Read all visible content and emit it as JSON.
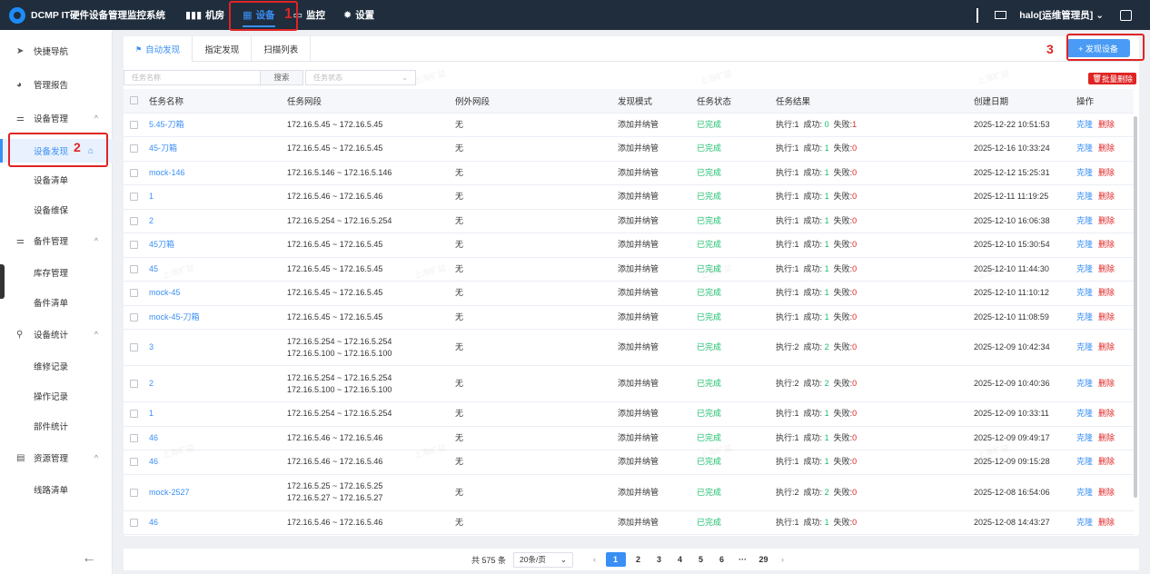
{
  "header": {
    "brand": "DCMP IT硬件设备管理监控系统",
    "nav": [
      {
        "label": "机房",
        "icon": "bar-chart-icon"
      },
      {
        "label": "设备",
        "icon": "grid-icon"
      },
      {
        "label": "监控",
        "icon": "monitor-icon"
      },
      {
        "label": "设置",
        "icon": "gear-icon"
      }
    ],
    "user": "halo[运维管理员]",
    "annotations": {
      "n1": "1",
      "n2": "2",
      "n3": "3"
    }
  },
  "sidebar": {
    "items": [
      {
        "label": "快捷导航",
        "icon": "send-icon"
      },
      {
        "label": "管理报告",
        "icon": "pie-icon"
      },
      {
        "label": "设备管理",
        "icon": "sliders-icon",
        "chevron": "^"
      },
      {
        "label": "设备发现"
      },
      {
        "label": "设备清单"
      },
      {
        "label": "设备维保"
      },
      {
        "label": "备件管理",
        "icon": "sliders-icon",
        "chevron": "^"
      },
      {
        "label": "库存管理"
      },
      {
        "label": "备件清单"
      },
      {
        "label": "设备统计",
        "icon": "search-icon",
        "chevron": "^"
      },
      {
        "label": "维修记录"
      },
      {
        "label": "操作记录"
      },
      {
        "label": "部件统计"
      },
      {
        "label": "资源管理",
        "icon": "table-icon",
        "chevron": "^"
      },
      {
        "label": "线路清单"
      }
    ]
  },
  "tabs": [
    "自动发现",
    "指定发现",
    "扫描列表"
  ],
  "buttons": {
    "add": "+ 发现设备",
    "batch_delete": "批量删除",
    "search": "搜索"
  },
  "filters": {
    "task_name_placeholder": "任务名称",
    "task_status_placeholder": "任务状态"
  },
  "table": {
    "columns": [
      "任务名称",
      "任务网段",
      "例外网段",
      "发现模式",
      "任务状态",
      "任务结果",
      "创建日期",
      "操作"
    ],
    "labels": {
      "exec": "执行:",
      "success": "成功:",
      "fail": "失败:",
      "clone": "克隆",
      "delete": "删除"
    },
    "rows": [
      {
        "name": "5.45-刀箱",
        "range": [
          "172.16.5.45 ~ 172.16.5.45"
        ],
        "exclude": "无",
        "mode": "添加并纳管",
        "status": "已完成",
        "exec": "1",
        "ok": "0",
        "fail": "1",
        "date": "2025-12-22 10:51:53"
      },
      {
        "name": "45-刀箱",
        "range": [
          "172.16.5.45 ~ 172.16.5.45"
        ],
        "exclude": "无",
        "mode": "添加并纳管",
        "status": "已完成",
        "exec": "1",
        "ok": "1",
        "fail": "0",
        "date": "2025-12-16 10:33:24"
      },
      {
        "name": "mock-146",
        "range": [
          "172.16.5.146 ~ 172.16.5.146"
        ],
        "exclude": "无",
        "mode": "添加并纳管",
        "status": "已完成",
        "exec": "1",
        "ok": "1",
        "fail": "0",
        "date": "2025-12-12 15:25:31"
      },
      {
        "name": "1",
        "range": [
          "172.16.5.46 ~ 172.16.5.46"
        ],
        "exclude": "无",
        "mode": "添加并纳管",
        "status": "已完成",
        "exec": "1",
        "ok": "1",
        "fail": "0",
        "date": "2025-12-11 11:19:25"
      },
      {
        "name": "2",
        "range": [
          "172.16.5.254 ~ 172.16.5.254"
        ],
        "exclude": "无",
        "mode": "添加并纳管",
        "status": "已完成",
        "exec": "1",
        "ok": "1",
        "fail": "0",
        "date": "2025-12-10 16:06:38"
      },
      {
        "name": "45刀箱",
        "range": [
          "172.16.5.45 ~ 172.16.5.45"
        ],
        "exclude": "无",
        "mode": "添加并纳管",
        "status": "已完成",
        "exec": "1",
        "ok": "1",
        "fail": "0",
        "date": "2025-12-10 15:30:54"
      },
      {
        "name": "45",
        "range": [
          "172.16.5.45 ~ 172.16.5.45"
        ],
        "exclude": "无",
        "mode": "添加并纳管",
        "status": "已完成",
        "exec": "1",
        "ok": "1",
        "fail": "0",
        "date": "2025-12-10 11:44:30"
      },
      {
        "name": "mock-45",
        "range": [
          "172.16.5.45 ~ 172.16.5.45"
        ],
        "exclude": "无",
        "mode": "添加并纳管",
        "status": "已完成",
        "exec": "1",
        "ok": "1",
        "fail": "0",
        "date": "2025-12-10 11:10:12"
      },
      {
        "name": "mock-45-刀箱",
        "range": [
          "172.16.5.45 ~ 172.16.5.45"
        ],
        "exclude": "无",
        "mode": "添加并纳管",
        "status": "已完成",
        "exec": "1",
        "ok": "1",
        "fail": "0",
        "date": "2025-12-10 11:08:59"
      },
      {
        "name": "3",
        "range": [
          "172.16.5.254 ~ 172.16.5.254",
          "172.16.5.100 ~ 172.16.5.100"
        ],
        "exclude": "无",
        "mode": "添加并纳管",
        "status": "已完成",
        "exec": "2",
        "ok": "2",
        "fail": "0",
        "date": "2025-12-09 10:42:34"
      },
      {
        "name": "2",
        "range": [
          "172.16.5.254 ~ 172.16.5.254",
          "172.16.5.100 ~ 172.16.5.100"
        ],
        "exclude": "无",
        "mode": "添加并纳管",
        "status": "已完成",
        "exec": "2",
        "ok": "2",
        "fail": "0",
        "date": "2025-12-09 10:40:36"
      },
      {
        "name": "1",
        "range": [
          "172.16.5.254 ~ 172.16.5.254"
        ],
        "exclude": "无",
        "mode": "添加并纳管",
        "status": "已完成",
        "exec": "1",
        "ok": "1",
        "fail": "0",
        "date": "2025-12-09 10:33:11"
      },
      {
        "name": "46",
        "range": [
          "172.16.5.46 ~ 172.16.5.46"
        ],
        "exclude": "无",
        "mode": "添加并纳管",
        "status": "已完成",
        "exec": "1",
        "ok": "1",
        "fail": "0",
        "date": "2025-12-09 09:49:17"
      },
      {
        "name": "46",
        "range": [
          "172.16.5.46 ~ 172.16.5.46"
        ],
        "exclude": "无",
        "mode": "添加并纳管",
        "status": "已完成",
        "exec": "1",
        "ok": "1",
        "fail": "0",
        "date": "2025-12-09 09:15:28"
      },
      {
        "name": "mock-2527",
        "range": [
          "172.16.5.25 ~ 172.16.5.25",
          "172.16.5.27 ~ 172.16.5.27"
        ],
        "exclude": "无",
        "mode": "添加并纳管",
        "status": "已完成",
        "exec": "2",
        "ok": "2",
        "fail": "0",
        "date": "2025-12-08 16:54:06"
      },
      {
        "name": "46",
        "range": [
          "172.16.5.46 ~ 172.16.5.46"
        ],
        "exclude": "无",
        "mode": "添加并纳管",
        "status": "已完成",
        "exec": "1",
        "ok": "1",
        "fail": "0",
        "date": "2025-12-08 14:43:27"
      }
    ]
  },
  "pagination": {
    "total": "共 575 条",
    "page_size": "20条/页",
    "pages": [
      "1",
      "2",
      "3",
      "4",
      "5",
      "6",
      "···",
      "29"
    ],
    "current": "1"
  },
  "watermark": "上海旷益"
}
